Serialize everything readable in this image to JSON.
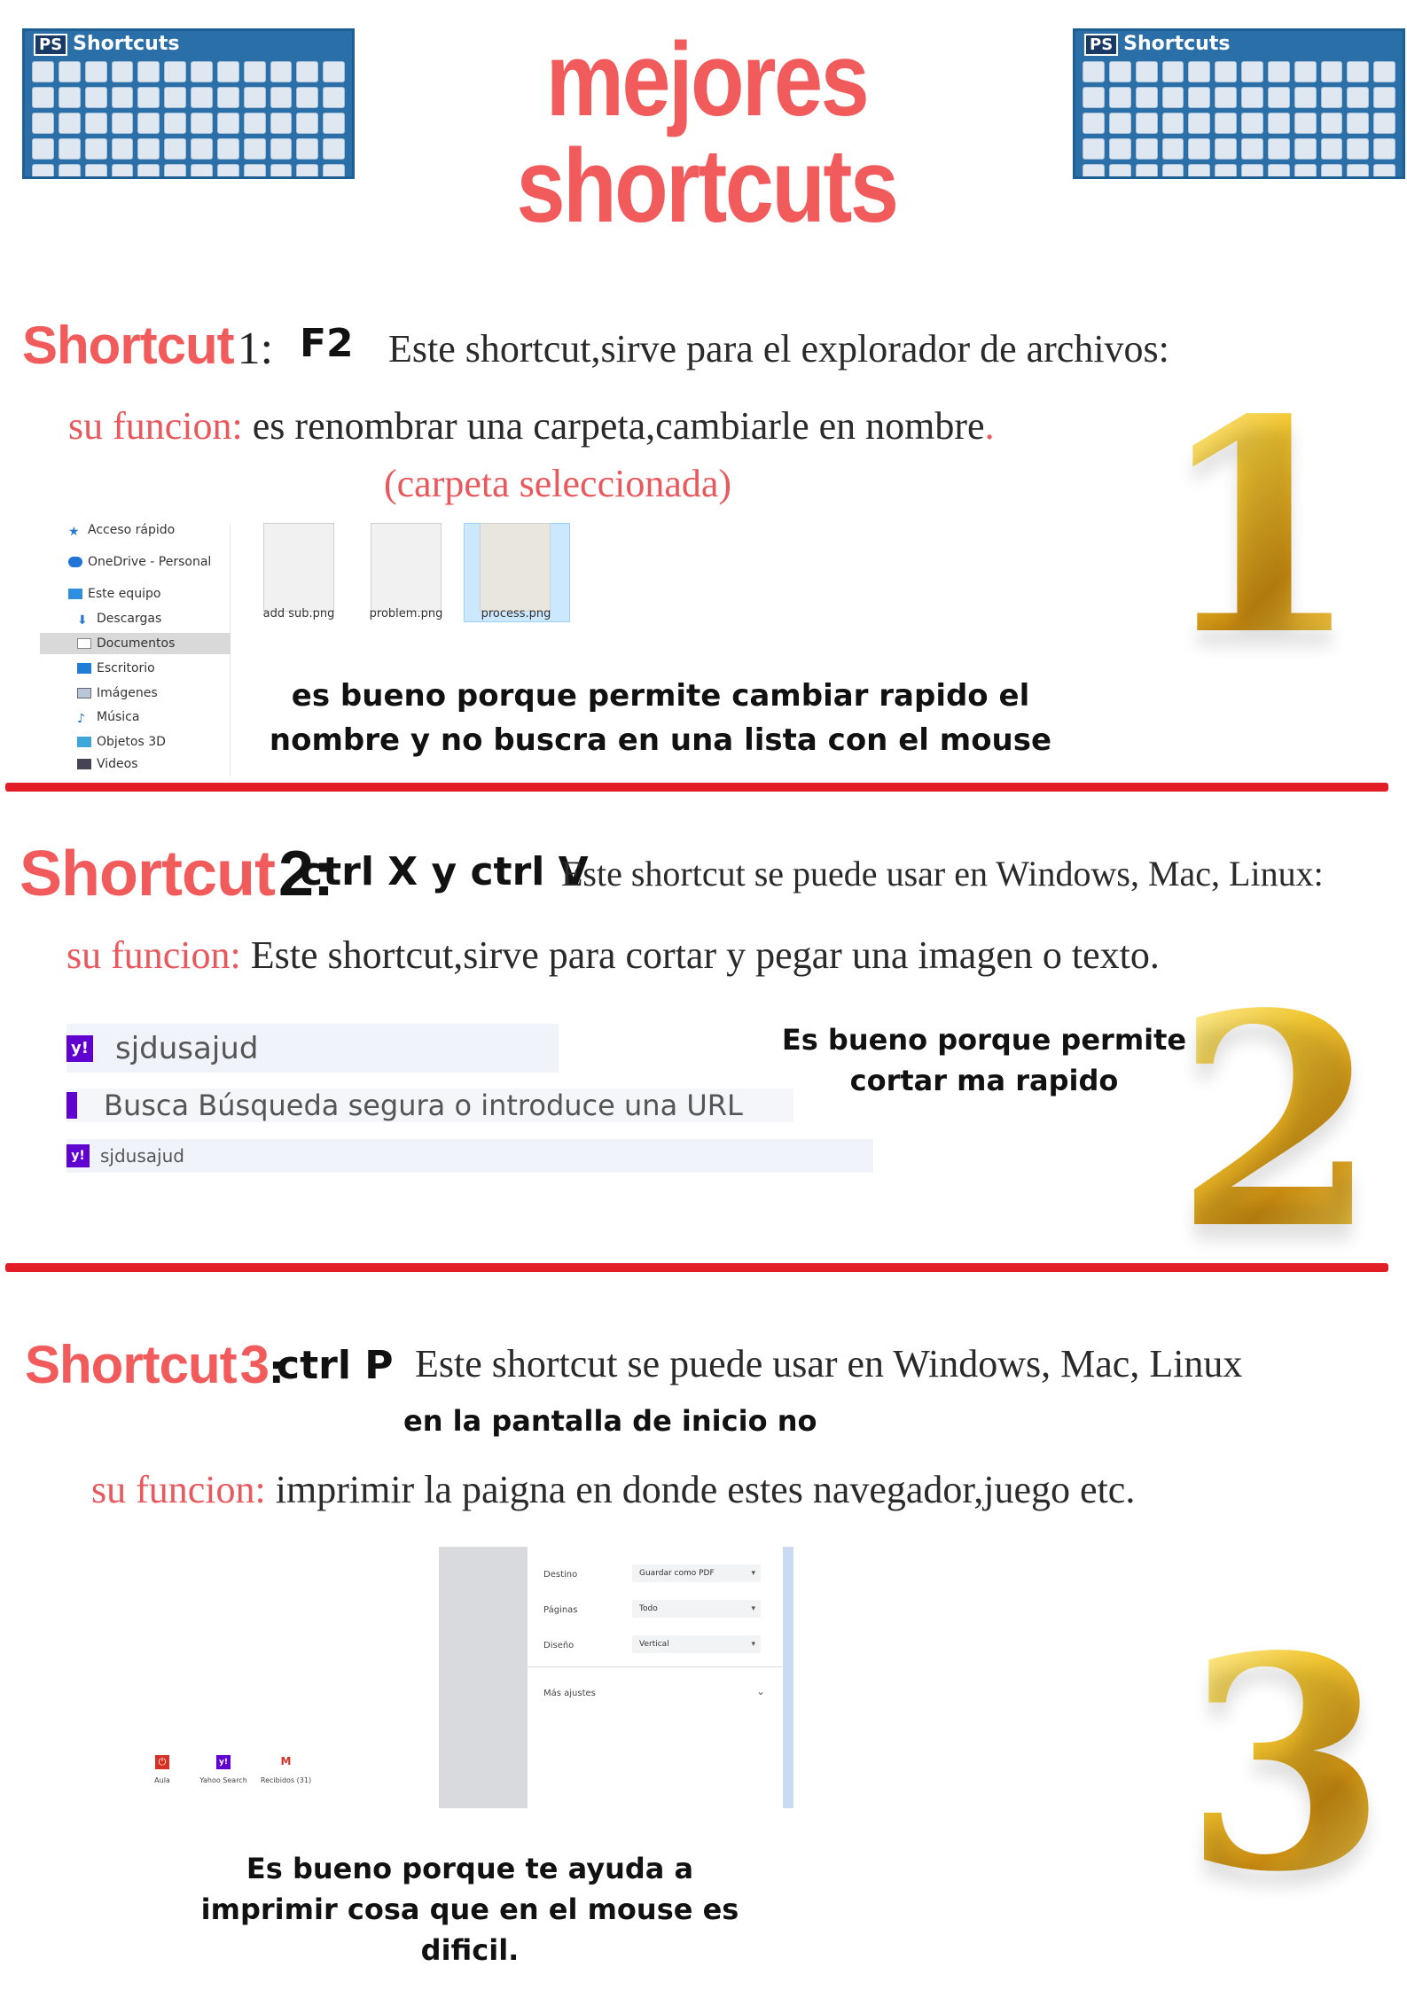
{
  "header": {
    "title": "mejores shortcuts",
    "keyboard_badge": "PS",
    "keyboard_title": "Shortcuts"
  },
  "shortcut1": {
    "word": "Shortcut",
    "number": "1:",
    "key": "F2",
    "usage": "Este shortcut,sirve para el explorador de archivos:",
    "func_label": "su funcion:",
    "func_text": "es renombrar una carpeta,cambiarle en nombre",
    "func_end": ".",
    "note": "(carpeta seleccionada)",
    "benefit_line1": "es bueno porque permite cambiar rapido el",
    "benefit_line2": "nombre y no buscra en una lista con el mouse",
    "big_number": "1",
    "explorer": {
      "nav_items": [
        "Acceso rápido",
        "OneDrive - Personal",
        "Este equipo",
        "Descargas",
        "Documentos",
        "Escritorio",
        "Imágenes",
        "Música",
        "Objetos 3D",
        "Videos"
      ],
      "files": [
        "add sub.png",
        "problem.png",
        "process.png"
      ]
    }
  },
  "shortcut2": {
    "word": "Shortcut",
    "number": "2:",
    "key": "ctrl X y ctrl V",
    "usage": "Este shortcut se puede usar en Windows, Mac, Linux:",
    "func_label": "su funcion:",
    "func_text": "Este shortcut,sirve para cortar y pegar una imagen o texto.",
    "benefit_line1": "Es bueno porque permite",
    "benefit_line2": "cortar ma rapido",
    "big_number": "2",
    "search": {
      "typed": "sjdusajud",
      "placeholder": "Busca Búsqueda segura o introduce una URL",
      "suggestion": "sjdusajud",
      "logo": "y!"
    }
  },
  "shortcut3": {
    "word": "Shortcut",
    "number": "3",
    "colon": ":",
    "key": "ctrl P",
    "usage": "Este shortcut se puede usar en Windows, Mac, Linux",
    "exception": "en la pantalla de inicio no",
    "func_label": "su funcion:",
    "func_text": "imprimir la paigna en donde estes navegador,juego etc.",
    "benefit_line1": "Es bueno porque te ayuda a",
    "benefit_line2": "imprimir cosa que en el mouse es",
    "benefit_line3": "dificil.",
    "big_number": "3",
    "print": {
      "destino_label": "Destino",
      "destino_value": "Guardar como PDF",
      "paginas_label": "Páginas",
      "paginas_value": "Todo",
      "diseno_label": "Diseño",
      "diseno_value": "Vertical",
      "more_label": "Más ajustes"
    },
    "apps": [
      "Aula",
      "Yahoo Search",
      "Recibidos (31)"
    ]
  },
  "colors": {
    "accent_red": "#f15b5b",
    "divider_red": "#e31d25",
    "gold": "#e6b422",
    "keyboard_blue": "#2a6fa8"
  }
}
